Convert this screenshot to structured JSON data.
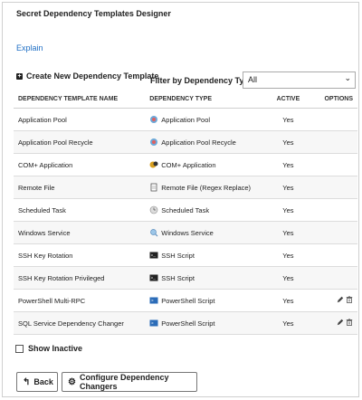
{
  "page": {
    "title": "Secret Dependency Templates Designer",
    "explain_link": "Explain",
    "create_label": "Create New Dependency Template",
    "filter_label": "Filter by Dependency Type",
    "filter_value": "All"
  },
  "table": {
    "headers": [
      "DEPENDENCY TEMPLATE NAME",
      "DEPENDENCY TYPE",
      "ACTIVE",
      "OPTIONS"
    ],
    "rows": [
      {
        "name": "Application Pool",
        "type": "Application Pool",
        "icon": "app-pool-icon",
        "active": "Yes"
      },
      {
        "name": "Application Pool Recycle",
        "type": "Application Pool Recycle",
        "icon": "app-pool-icon",
        "active": "Yes"
      },
      {
        "name": "COM+ Application",
        "type": "COM+ Application",
        "icon": "com-app-icon",
        "active": "Yes"
      },
      {
        "name": "Remote File",
        "type": "Remote File (Regex Replace)",
        "icon": "file-icon",
        "active": "Yes"
      },
      {
        "name": "Scheduled Task",
        "type": "Scheduled Task",
        "icon": "clock-icon",
        "active": "Yes"
      },
      {
        "name": "Windows Service",
        "type": "Windows Service",
        "icon": "service-icon",
        "active": "Yes"
      },
      {
        "name": "SSH Key Rotation",
        "type": "SSH Script",
        "icon": "terminal-icon",
        "active": "Yes"
      },
      {
        "name": "SSH Key Rotation Privileged",
        "type": "SSH Script",
        "icon": "terminal-icon",
        "active": "Yes"
      },
      {
        "name": "PowerShell Multi-RPC",
        "type": "PowerShell Script",
        "icon": "powershell-icon",
        "active": "Yes",
        "options": true
      },
      {
        "name": "SQL Service Dependency Changer",
        "type": "PowerShell Script",
        "icon": "powershell-icon",
        "active": "Yes",
        "options": true
      }
    ]
  },
  "footer": {
    "show_inactive_label": "Show Inactive",
    "back_label": "Back",
    "config_label": "Configure Dependency Changers"
  }
}
